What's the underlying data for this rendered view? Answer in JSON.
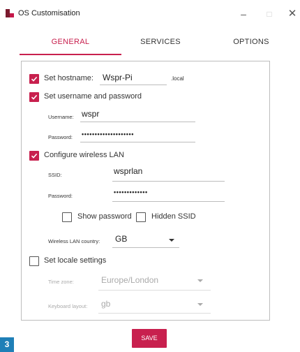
{
  "window": {
    "title": "OS Customisation",
    "minimize_glyph": "–",
    "maximize_glyph": "□",
    "close_glyph": "✕"
  },
  "tabs": [
    {
      "label": "GENERAL",
      "active": true
    },
    {
      "label": "SERVICES",
      "active": false
    },
    {
      "label": "OPTIONS",
      "active": false
    }
  ],
  "general": {
    "hostname": {
      "label": "Set hostname:",
      "checked": true,
      "value": "Wspr-Pi",
      "suffix": ".local"
    },
    "user": {
      "label": "Set username and password",
      "checked": true,
      "username_label": "Username:",
      "username_value": "wspr",
      "password_label": "Password:",
      "password_value": "••••••••••••••••••••"
    },
    "wlan": {
      "label": "Configure wireless LAN",
      "checked": true,
      "ssid_label": "SSID:",
      "ssid_value": "wsprlan",
      "password_label": "Password:",
      "password_value": "•••••••••••••",
      "show_password_label": "Show password",
      "show_password_checked": false,
      "hidden_ssid_label": "Hidden SSID",
      "hidden_ssid_checked": false,
      "country_label": "Wireless LAN country:",
      "country_value": "GB"
    },
    "locale": {
      "label": "Set locale settings",
      "checked": false,
      "timezone_label": "Time zone:",
      "timezone_value": "Europe/London",
      "keyboard_label": "Keyboard layout:",
      "keyboard_value": "gb"
    }
  },
  "save_label": "SAVE",
  "corner_badge": "3",
  "colors": {
    "accent": "#c8204e",
    "badge": "#1f7fb7"
  }
}
